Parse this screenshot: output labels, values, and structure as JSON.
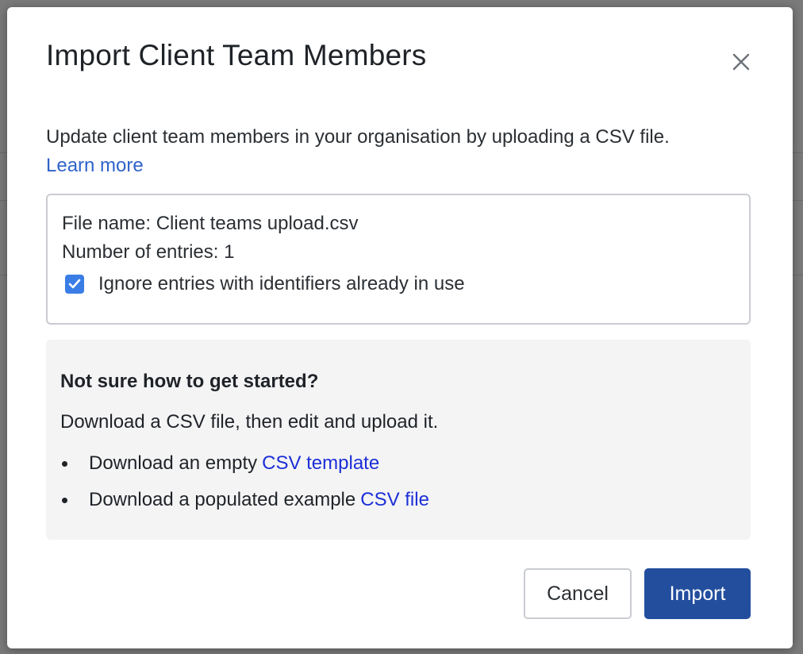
{
  "modal": {
    "title": "Import Client Team Members",
    "description": "Update client team members in your organisation by uploading a CSV file.",
    "learn_more_label": "Learn more"
  },
  "file_info": {
    "file_name_text": "File name: Client teams upload.csv",
    "entries_text": "Number of entries: 1",
    "ignore_checkbox_label": "Ignore entries with identifiers already in use",
    "ignore_checked": true
  },
  "help": {
    "heading": "Not sure how to get started?",
    "text": "Download a CSV file, then edit and upload it.",
    "items": [
      {
        "text": "Download an empty",
        "link": "CSV template"
      },
      {
        "text": "Download a populated example",
        "link": "CSV file"
      }
    ]
  },
  "actions": {
    "cancel_label": "Cancel",
    "import_label": "Import"
  },
  "colors": {
    "primary": "#234e9e",
    "link": "#2f63c9",
    "checkbox": "#3b7de6",
    "help_link": "#1c2fd6"
  },
  "icons": {
    "close": "close-icon",
    "check": "checkmark-icon",
    "bullet": "bullet-icon"
  }
}
